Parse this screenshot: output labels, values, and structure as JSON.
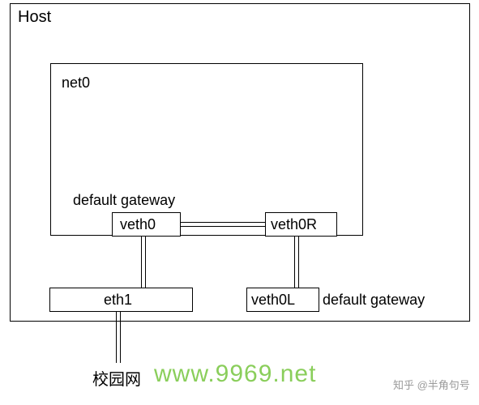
{
  "host": {
    "label": "Host"
  },
  "net0": {
    "label": "net0"
  },
  "gateway1": {
    "label": "default gateway"
  },
  "veth0": {
    "label": "veth0"
  },
  "veth0R": {
    "label": "veth0R"
  },
  "eth1": {
    "label": "eth1"
  },
  "veth0L": {
    "label": "veth0L"
  },
  "gateway2": {
    "label": "default gateway"
  },
  "campus": {
    "label": "校园网"
  },
  "watermark": {
    "green": "www.9969.net",
    "gray": "知乎 @半角句号"
  }
}
